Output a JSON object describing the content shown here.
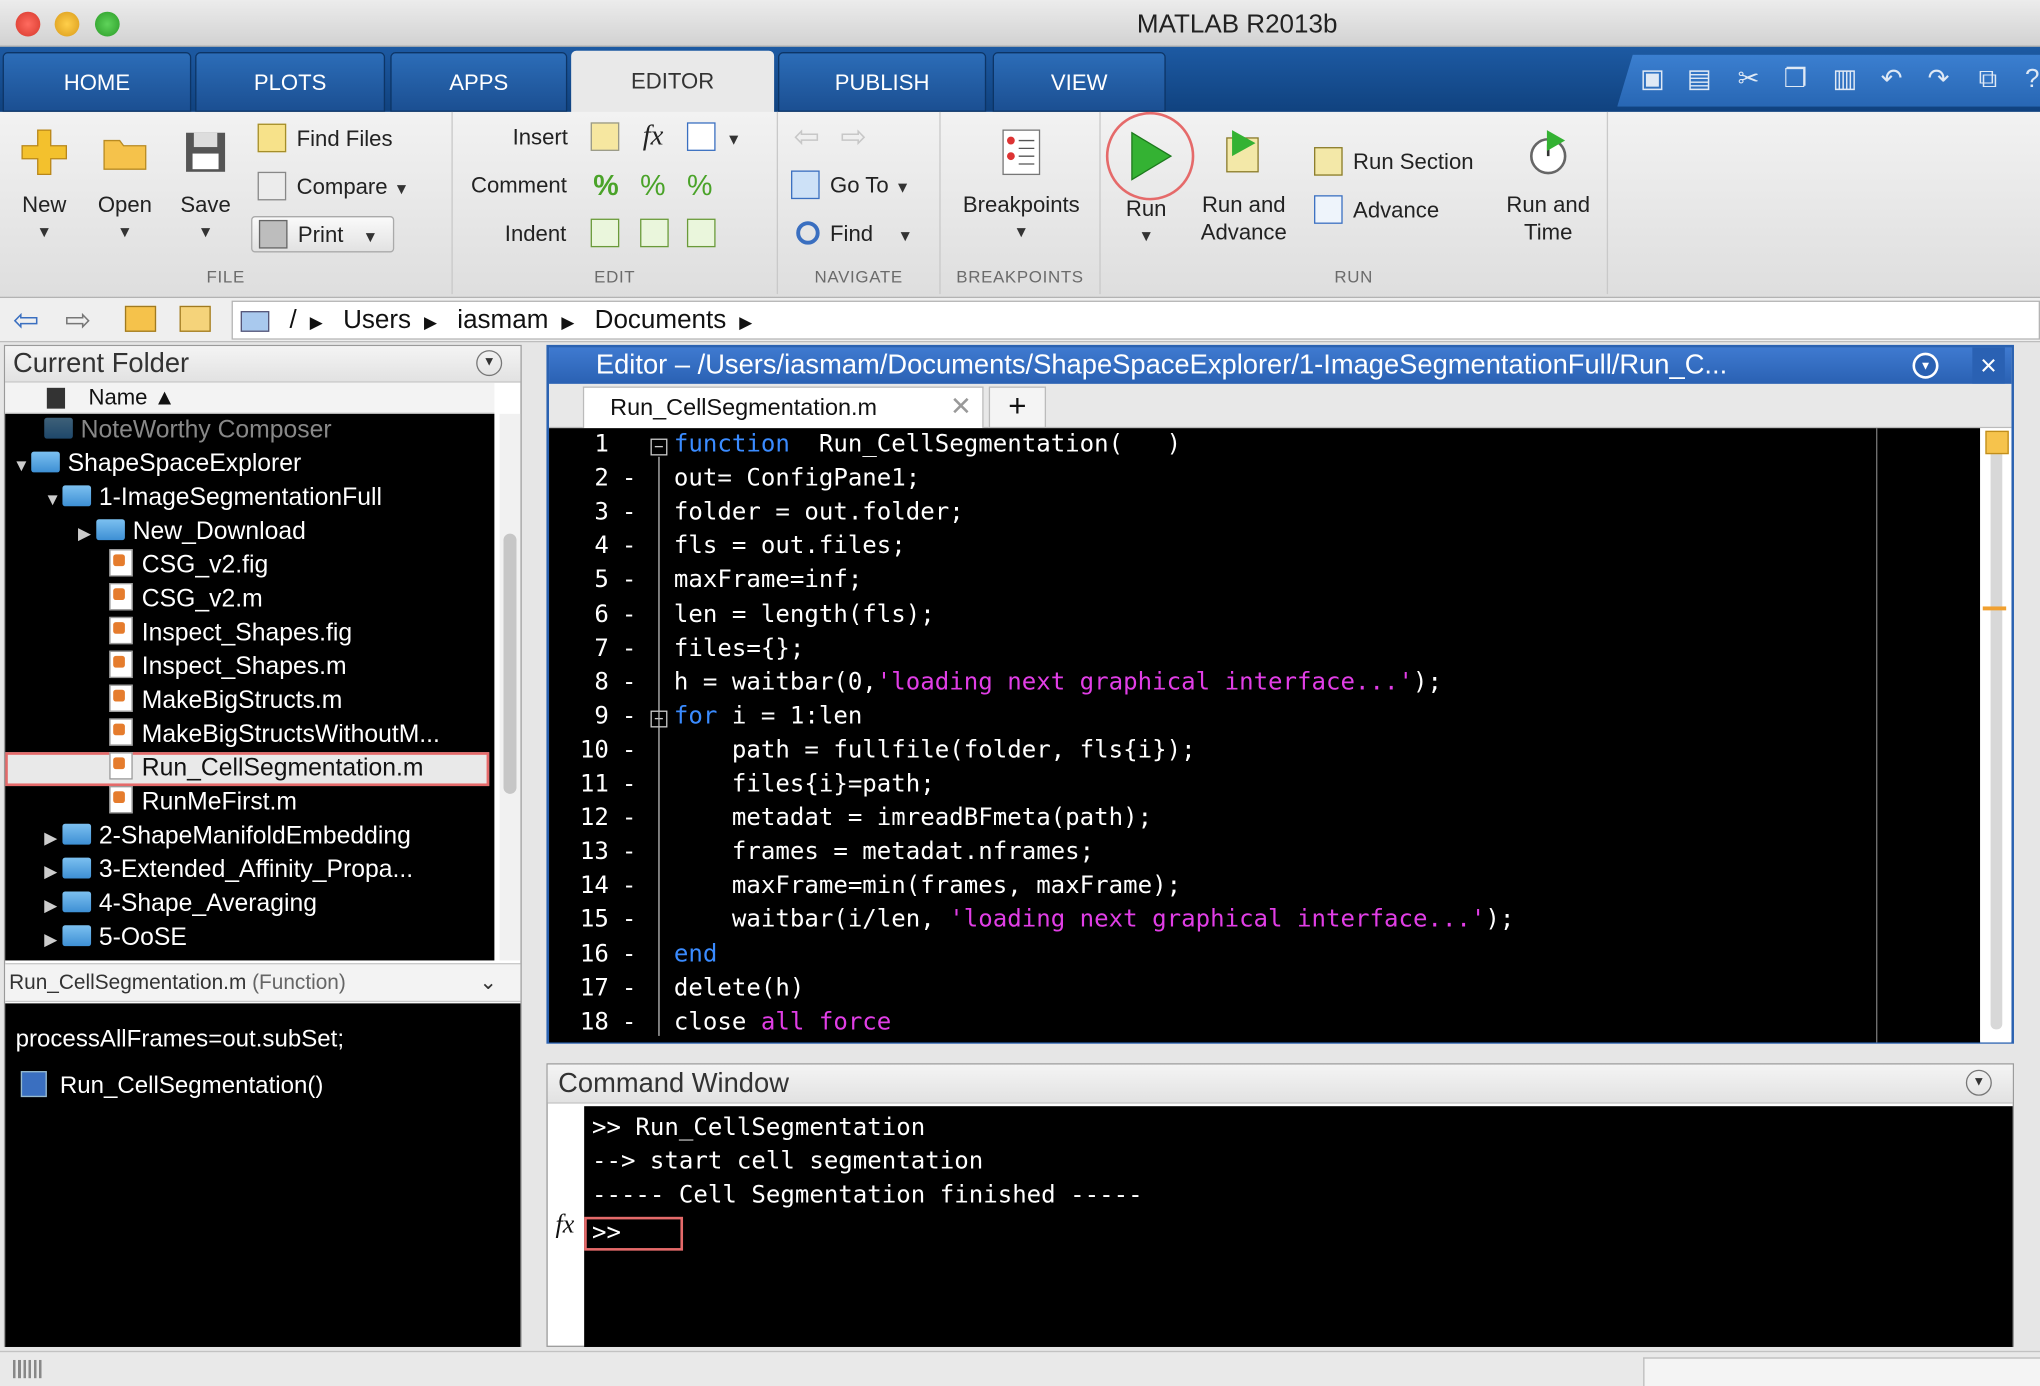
{
  "window": {
    "title": "MATLAB R2013b"
  },
  "tabs": [
    "HOME",
    "PLOTS",
    "APPS",
    "EDITOR",
    "PUBLISH",
    "VIEW"
  ],
  "ribbon": {
    "file": {
      "label": "FILE",
      "new": "New",
      "open": "Open",
      "save": "Save",
      "find_files": "Find Files",
      "compare": "Compare",
      "print": "Print"
    },
    "edit": {
      "label": "EDIT",
      "insert": "Insert",
      "comment": "Comment",
      "indent": "Indent",
      "fx": "fx"
    },
    "navigate": {
      "label": "NAVIGATE",
      "goto": "Go To",
      "find": "Find"
    },
    "breakpoints": {
      "label": "BREAKPOINTS",
      "breakpoints": "Breakpoints"
    },
    "run": {
      "label": "RUN",
      "run": "Run",
      "run_and_advance_1": "Run and",
      "run_and_advance_2": "Advance",
      "run_section": "Run Section",
      "advance": "Advance",
      "run_and_time_1": "Run and",
      "run_and_time_2": "Time"
    }
  },
  "path": {
    "root": "/",
    "segments": [
      "Users",
      "iasmam",
      "Documents"
    ]
  },
  "current_folder": {
    "title": "Current Folder",
    "column": "Name ▲",
    "items": [
      {
        "label": "NoteWorthy Composer",
        "type": "folder"
      },
      {
        "label": "ShapeSpaceExplorer",
        "type": "folder"
      },
      {
        "label": "1-ImageSegmentationFull",
        "type": "folder"
      },
      {
        "label": "New_Download",
        "type": "folder"
      },
      {
        "label": "CSG_v2.fig",
        "type": "file"
      },
      {
        "label": "CSG_v2.m",
        "type": "file"
      },
      {
        "label": "Inspect_Shapes.fig",
        "type": "file"
      },
      {
        "label": "Inspect_Shapes.m",
        "type": "file"
      },
      {
        "label": "MakeBigStructs.m",
        "type": "file"
      },
      {
        "label": "MakeBigStructsWithoutM...",
        "type": "file"
      },
      {
        "label": "Run_CellSegmentation.m",
        "type": "file"
      },
      {
        "label": "RunMeFirst.m",
        "type": "file"
      },
      {
        "label": "2-ShapeManifoldEmbedding",
        "type": "folder"
      },
      {
        "label": "3-Extended_Affinity_Propa...",
        "type": "folder"
      },
      {
        "label": "4-Shape_Averaging",
        "type": "folder"
      },
      {
        "label": "5-OoSE",
        "type": "folder"
      }
    ],
    "details_name": "Run_CellSegmentation.m",
    "details_type": "(Function)",
    "details_line1": "processAllFrames=out.subSet;",
    "details_line2": "Run_CellSegmentation()"
  },
  "editor": {
    "title": "Editor – /Users/iasmam/Documents/ShapeSpaceExplorer/1-ImageSegmentationFull/Run_C...",
    "tab": "Run_CellSegmentation.m",
    "add_tab": "+",
    "lines": [
      {
        "n": "1",
        "m": "",
        "t": [
          [
            "kw",
            "function"
          ],
          [
            "",
            "  Run_CellSegmentation(   )"
          ]
        ]
      },
      {
        "n": "2",
        "m": "-",
        "t": [
          [
            "",
            "out= ConfigPane1;"
          ]
        ]
      },
      {
        "n": "3",
        "m": "-",
        "t": [
          [
            "",
            "folder = out.folder;"
          ]
        ]
      },
      {
        "n": "4",
        "m": "-",
        "t": [
          [
            "",
            "fls = out.files;"
          ]
        ]
      },
      {
        "n": "5",
        "m": "-",
        "t": [
          [
            "",
            "maxFrame=inf;"
          ]
        ]
      },
      {
        "n": "6",
        "m": "-",
        "t": [
          [
            "",
            "len = length(fls);"
          ]
        ]
      },
      {
        "n": "7",
        "m": "-",
        "t": [
          [
            "",
            "files={};"
          ]
        ]
      },
      {
        "n": "8",
        "m": "-",
        "t": [
          [
            "",
            "h = waitbar(0,"
          ],
          [
            "str",
            "'loading next graphical interface...'"
          ],
          [
            "",
            ");"
          ]
        ]
      },
      {
        "n": "9",
        "m": "-",
        "t": [
          [
            "kw",
            "for"
          ],
          [
            "",
            " i = 1:len"
          ]
        ]
      },
      {
        "n": "10",
        "m": "-",
        "t": [
          [
            "",
            "    path = fullfile(folder, fls{i});"
          ]
        ]
      },
      {
        "n": "11",
        "m": "-",
        "t": [
          [
            "",
            "    files{i}=path;"
          ]
        ]
      },
      {
        "n": "12",
        "m": "-",
        "t": [
          [
            "",
            "    metadat = imreadBFmeta(path);"
          ]
        ]
      },
      {
        "n": "13",
        "m": "-",
        "t": [
          [
            "",
            "    frames = metadat.nframes;"
          ]
        ]
      },
      {
        "n": "14",
        "m": "-",
        "t": [
          [
            "",
            "    maxFrame=min(frames, maxFrame);"
          ]
        ]
      },
      {
        "n": "15",
        "m": "-",
        "t": [
          [
            "",
            "    waitbar(i/len, "
          ],
          [
            "str",
            "'loading next graphical interface...'"
          ],
          [
            "",
            ");"
          ]
        ]
      },
      {
        "n": "16",
        "m": "-",
        "t": [
          [
            "kw",
            "end"
          ]
        ]
      },
      {
        "n": "17",
        "m": "-",
        "t": [
          [
            "",
            "delete(h)"
          ]
        ]
      },
      {
        "n": "18",
        "m": "-",
        "t": [
          [
            "",
            "close "
          ],
          [
            "str",
            "all force"
          ]
        ]
      }
    ]
  },
  "command_window": {
    "title": "Command Window",
    "lines": [
      ">> Run_CellSegmentation",
      "--> start cell segmentation",
      "----- Cell Segmentation finished -----"
    ],
    "prompt": ">>",
    "fx": "fx"
  }
}
